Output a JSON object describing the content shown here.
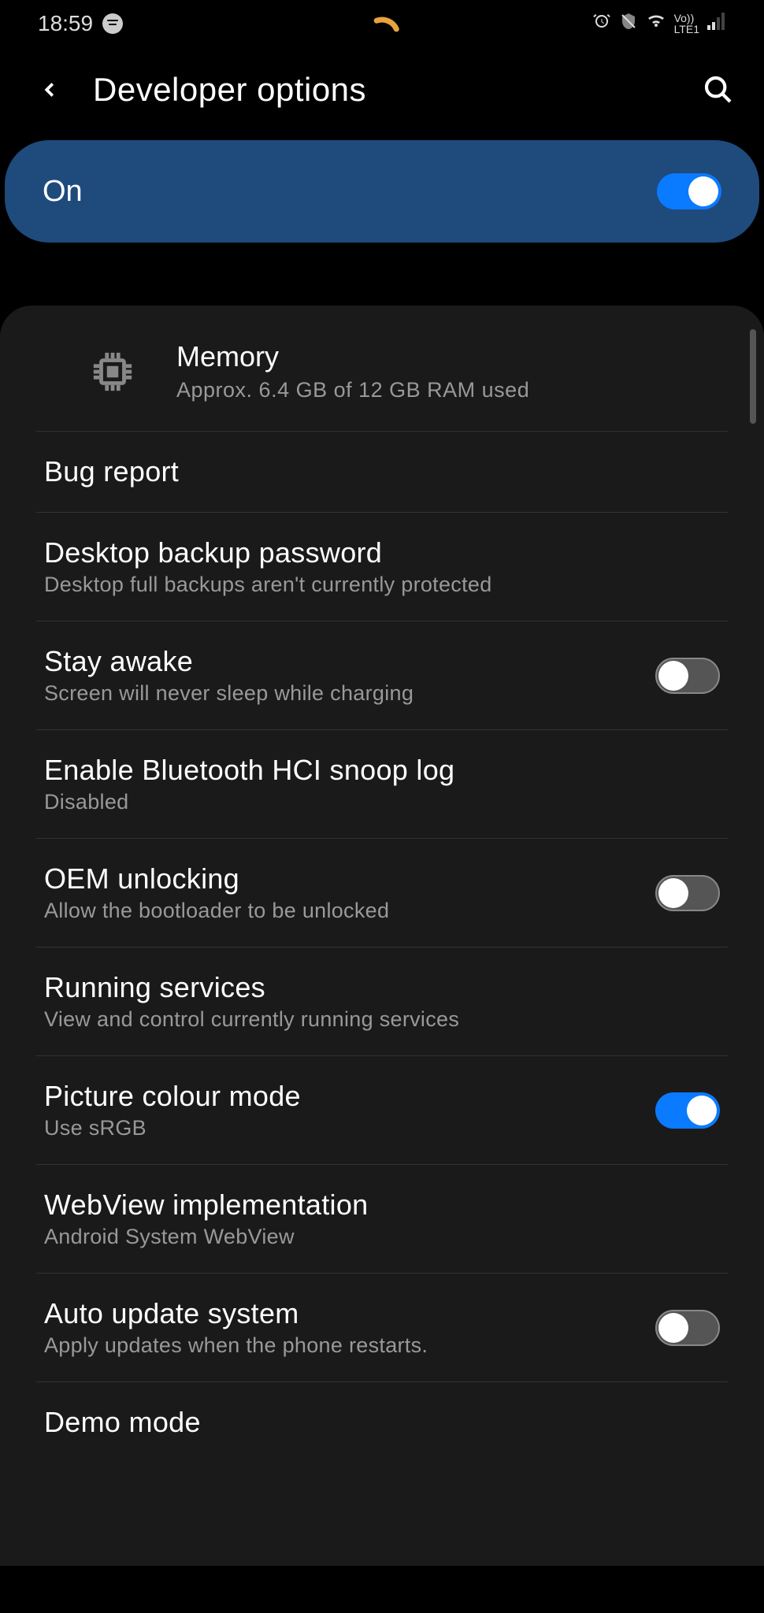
{
  "status_bar": {
    "time": "18:59",
    "network_label": "LTE1",
    "volte_label": "Vo))"
  },
  "header": {
    "title": "Developer options"
  },
  "master_toggle": {
    "label": "On",
    "state": true
  },
  "memory": {
    "title": "Memory",
    "subtitle": "Approx. 6.4 GB of 12 GB RAM used"
  },
  "settings": [
    {
      "id": "bug-report",
      "title": "Bug report",
      "subtitle": "",
      "has_toggle": false
    },
    {
      "id": "desktop-backup-password",
      "title": "Desktop backup password",
      "subtitle": "Desktop full backups aren't currently protected",
      "has_toggle": false
    },
    {
      "id": "stay-awake",
      "title": "Stay awake",
      "subtitle": "Screen will never sleep while charging",
      "has_toggle": true,
      "toggle_state": false
    },
    {
      "id": "bluetooth-hci-snoop",
      "title": "Enable Bluetooth HCI snoop log",
      "subtitle": "Disabled",
      "has_toggle": false
    },
    {
      "id": "oem-unlocking",
      "title": "OEM unlocking",
      "subtitle": "Allow the bootloader to be unlocked",
      "has_toggle": true,
      "toggle_state": false
    },
    {
      "id": "running-services",
      "title": "Running services",
      "subtitle": "View and control currently running services",
      "has_toggle": false
    },
    {
      "id": "picture-colour-mode",
      "title": "Picture colour mode",
      "subtitle": "Use sRGB",
      "has_toggle": true,
      "toggle_state": true
    },
    {
      "id": "webview-implementation",
      "title": "WebView implementation",
      "subtitle": "Android System WebView",
      "has_toggle": false
    },
    {
      "id": "auto-update-system",
      "title": "Auto update system",
      "subtitle": "Apply updates when the phone restarts.",
      "has_toggle": true,
      "toggle_state": false
    },
    {
      "id": "demo-mode",
      "title": "Demo mode",
      "subtitle": "",
      "has_toggle": false
    }
  ]
}
